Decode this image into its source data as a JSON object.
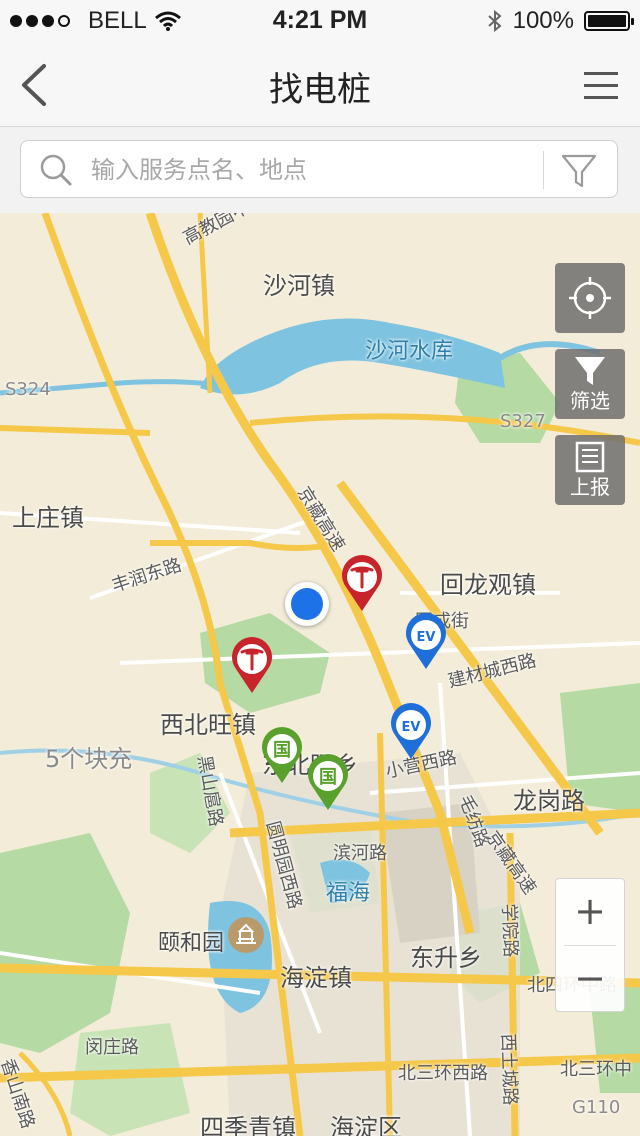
{
  "status_bar": {
    "carrier": "BELL",
    "time": "4:21 PM",
    "battery": "100%"
  },
  "navbar": {
    "title": "找电桩"
  },
  "search": {
    "placeholder": "输入服务点名、地点"
  },
  "map_controls": {
    "filter_label": "筛选",
    "report_label": "上报",
    "zoom_in": "+",
    "zoom_out": "−"
  },
  "map_labels": {
    "gaojiaoyuan": "高教园中街",
    "shahe_town": "沙河镇",
    "shahe_reservoir": "沙河水库",
    "s324": "S324",
    "s327": "S327",
    "shangzhuang": "上庄镇",
    "fengrun": "丰润东路",
    "jingzang": "京藏高速",
    "huilongguan": "回龙观镇",
    "tongcheng": "同成街",
    "jiancai": "建材城西路",
    "xibeiwang": "西北旺镇",
    "wugekuaichong": "5个块充",
    "dongbeiwang": "东北旺乡",
    "xiaoying": "小营西路",
    "maofang": "毛纺路",
    "longgang": "龙岗路",
    "heishanhu": "黑山扈路",
    "yuanmingyuan": "圆明园西路",
    "binhe": "滨河路",
    "fuhai": "福海",
    "yiheyuan": "颐和园",
    "haidian_town": "海淀镇",
    "dongsheng": "东升乡",
    "xueyuan": "学院路",
    "beisihuan": "北四环中路",
    "minzhuang": "闵庄路",
    "xiangshan": "香山南路",
    "beisanhuan_w": "北三环西路",
    "beisanhuan_m": "北三环中",
    "sijiqing": "四季青镇",
    "haidian_dist": "海淀区",
    "xishangcheng": "西土城路",
    "g110": "G110"
  },
  "pins": [
    {
      "type": "tesla",
      "glyph": "T",
      "color": "#c8242b"
    },
    {
      "type": "tesla",
      "glyph": "T",
      "color": "#c8242b"
    },
    {
      "type": "ev",
      "glyph": "EV",
      "color": "#1e6fd9"
    },
    {
      "type": "ev",
      "glyph": "EV",
      "color": "#1e6fd9"
    },
    {
      "type": "state-grid",
      "glyph": "国",
      "color": "#5aa02c"
    },
    {
      "type": "state-grid",
      "glyph": "国",
      "color": "#5aa02c"
    }
  ]
}
